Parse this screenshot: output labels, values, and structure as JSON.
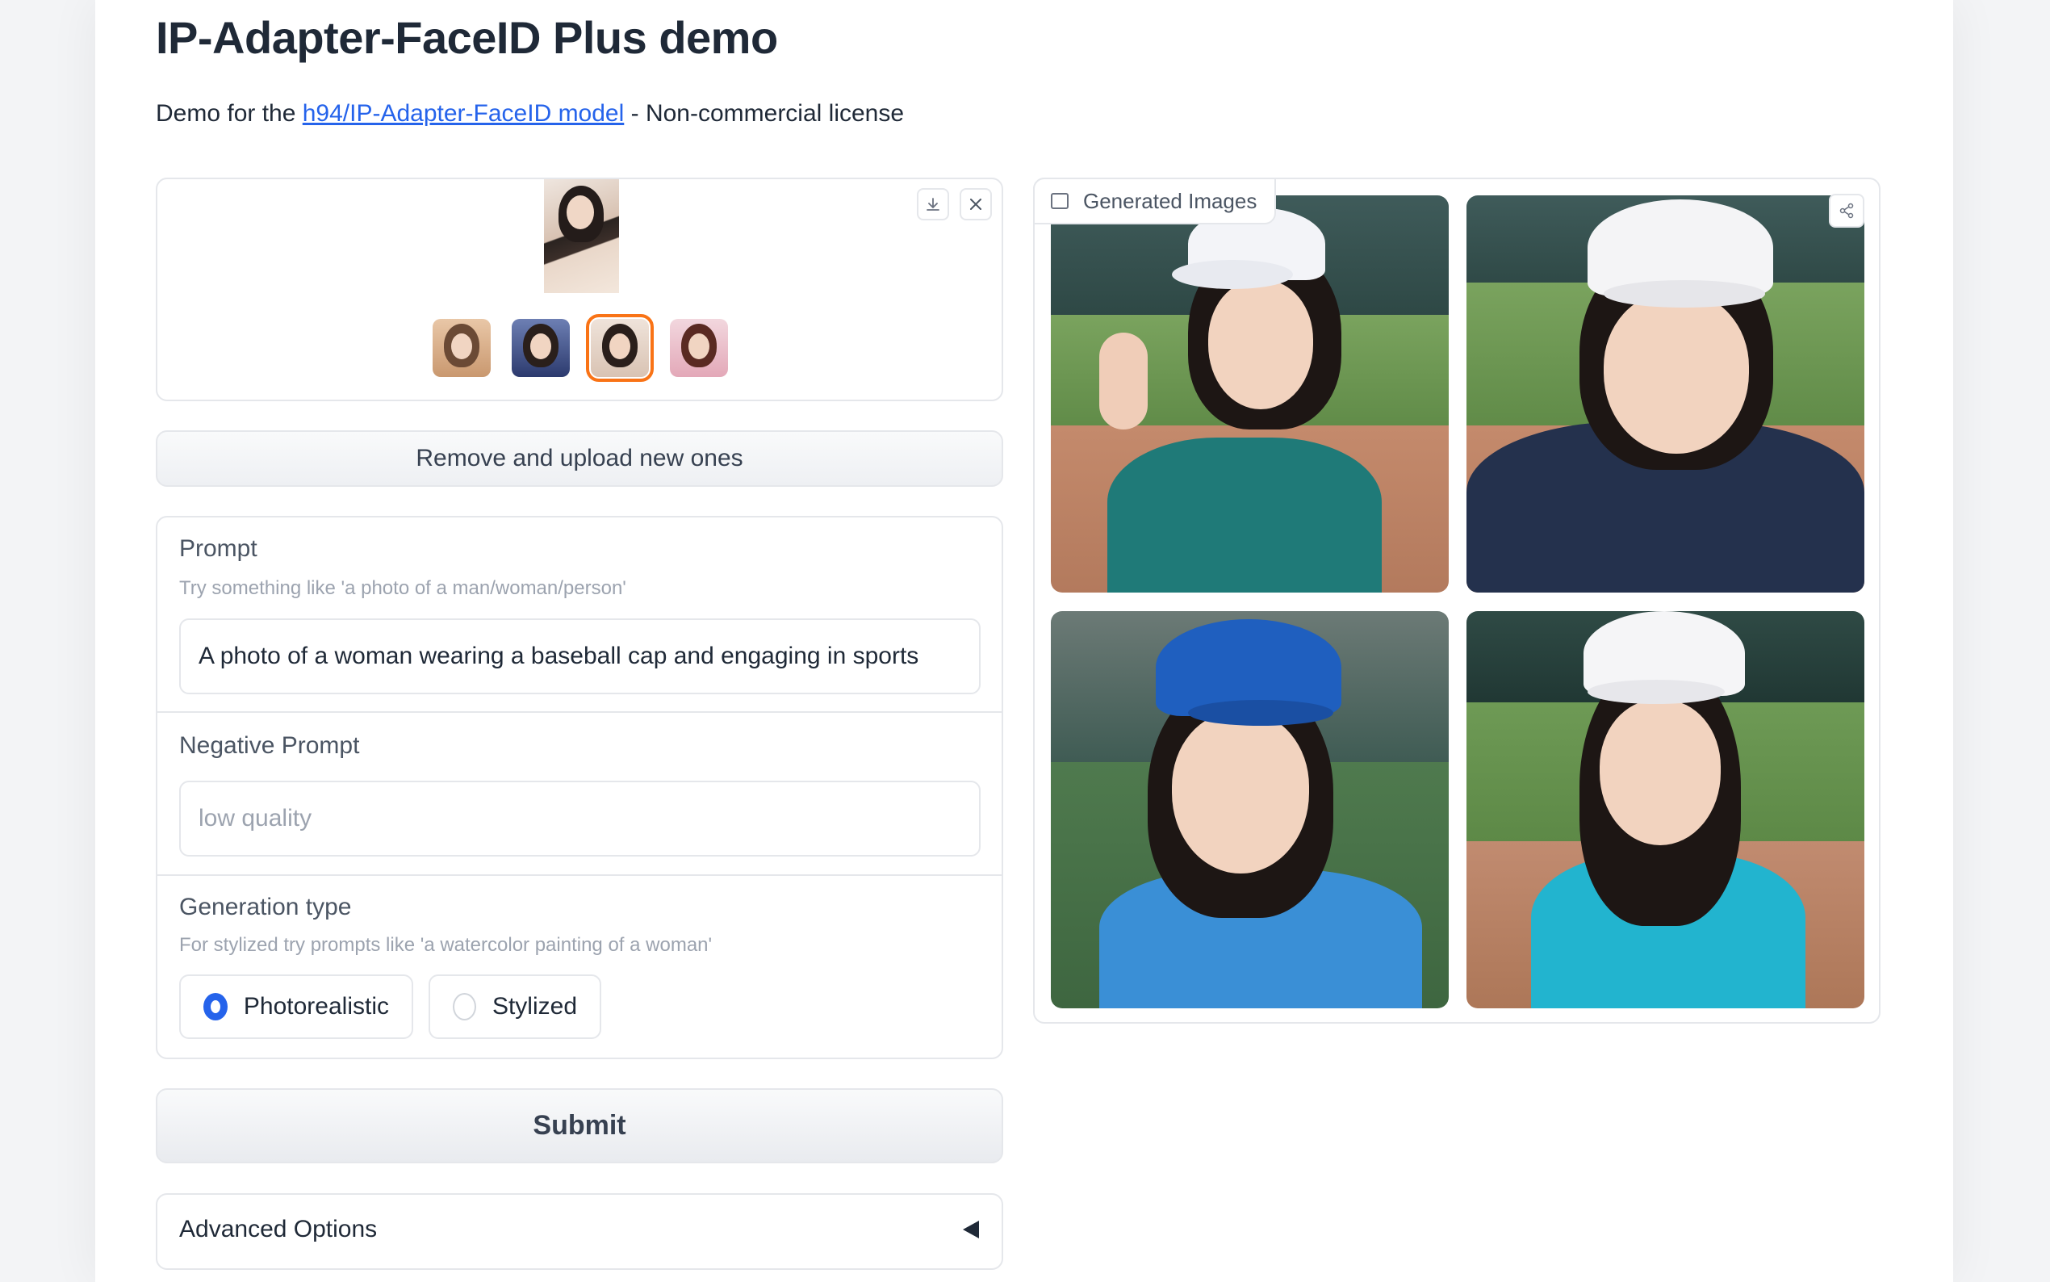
{
  "app": {
    "title": "IP-Adapter-FaceID Plus demo",
    "subtitle_prefix": "Demo for the ",
    "subtitle_link": "h94/IP-Adapter-FaceID model",
    "subtitle_suffix": " - Non-commercial license"
  },
  "upload": {
    "download_icon": "download-icon",
    "close_icon": "close-icon",
    "thumbnails_count": 4,
    "selected_thumbnail": 3
  },
  "buttons": {
    "remove_label": "Remove and upload new ones",
    "submit_label": "Submit"
  },
  "prompt": {
    "label": "Prompt",
    "info": "Try something like 'a photo of a man/woman/person'",
    "value": "A photo of a woman wearing a baseball cap and engaging in sports"
  },
  "negative_prompt": {
    "label": "Negative Prompt",
    "placeholder": "low quality"
  },
  "generation_type": {
    "label": "Generation type",
    "info": "For stylized try prompts like 'a watercolor painting of a woman'",
    "options": [
      "Photorealistic",
      "Stylized"
    ],
    "selected": "Photorealistic"
  },
  "advanced": {
    "label": "Advanced Options"
  },
  "gallery": {
    "label": "Generated Images",
    "image_icon": "image-icon",
    "share_icon": "share-icon",
    "image_count": 4
  },
  "colors": {
    "accent": "#2563eb",
    "selected_outline": "#f97316",
    "border": "#e5e7eb"
  }
}
